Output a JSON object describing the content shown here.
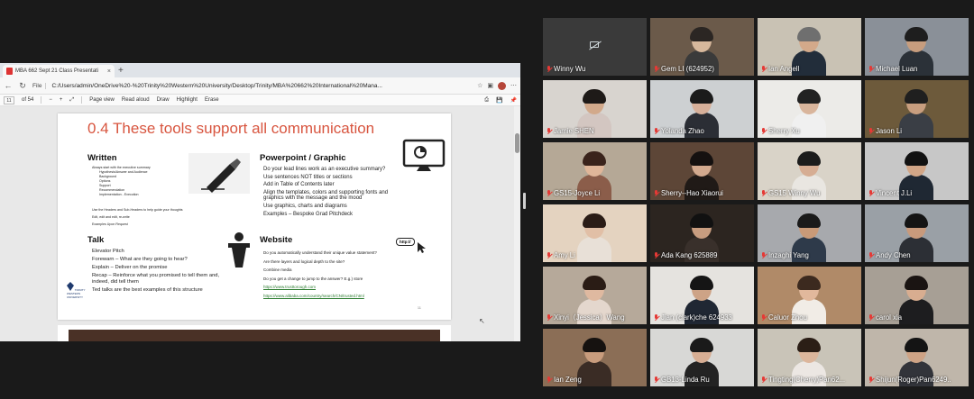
{
  "browser": {
    "tab_title": "MBA 662 Sept 21 Class Presentati",
    "tab_close": "×",
    "new_tab": "+",
    "file_label": "File",
    "url": "C:/Users/admin/OneDrive%20-%20Trinity%20Western%20University/Desktop/Trinity/MBA%20662%20International%20Mana...",
    "page_input": "11",
    "page_total": "of 54",
    "toolbar": [
      "Page view",
      "Read aloud",
      "Draw",
      "Highlight",
      "Erase"
    ]
  },
  "slide": {
    "title": "0.4  These tools support all communication",
    "written": {
      "heading": "Written",
      "bullets": [
        "Always start with the executive summary"
      ],
      "sub_bullets": [
        "Hypothesis/Answer and Audience",
        "Background",
        "Options",
        "Support",
        "Recommendation",
        "Implementation - Execution"
      ],
      "more_bullets": [
        "Use the Headers and Sub-Headers to help guide your thoughts",
        "Edit, edit and edit, re-write",
        "Examples Upon Request"
      ]
    },
    "powerpoint": {
      "heading": "Powerpoint / Graphic",
      "bullets": [
        "Do your lead lines work as an executive summary?",
        "Use sentences NOT titles or sections",
        "Add in Table of Contents later",
        "Align the templates, colors and supporting fonts and",
        "graphics with the message and the mood",
        "Use graphics, charts and diagrams",
        "Examples – Bespoke Grad Pitchdeck"
      ]
    },
    "talk": {
      "heading": "Talk",
      "bullets": [
        "Elevator Pitch",
        "Forewarn – What are they going to hear?",
        "Explain – Deliver on the promise",
        "Recap – Reinforce what you promised to tell them and,",
        "indeed, did tell them",
        "Ted talks are the best examples of this structure"
      ]
    },
    "website": {
      "heading": "Website",
      "http_badge": "http://",
      "bullets": [
        "Do you automatically understand their unique value statement?",
        "Are there layers and logical depth to the site?",
        "Combine media",
        "Do you get a change to jump to the answer? E.g.) store"
      ],
      "links": [
        "https://www.trusttorough.com",
        "https://www.alibaba.com/country/search/CN/trusted.html"
      ]
    },
    "logo_text": "TRINITY WESTERN UNIVERSITY",
    "page_number": "11"
  },
  "participants": [
    {
      "name": "Winny Wu",
      "video": false
    },
    {
      "name": "Gem LI (624952)",
      "video": true
    },
    {
      "name": "Ian Angell",
      "video": true,
      "active": true
    },
    {
      "name": "Michael Luan",
      "video": true
    },
    {
      "name": "Jamie SHEN",
      "video": true
    },
    {
      "name": "Yolanda Zhao",
      "video": true
    },
    {
      "name": "Sherry Xu",
      "video": true
    },
    {
      "name": "Jason Li",
      "video": true
    },
    {
      "name": "GS15-Joyce Li",
      "video": true
    },
    {
      "name": "Sherry--Hao Xiaorui",
      "video": true
    },
    {
      "name": "GS15 Winny Wu",
      "video": true
    },
    {
      "name": "Vincent J.Li",
      "video": true
    },
    {
      "name": "Amy Li",
      "video": true
    },
    {
      "name": "Ada Kang 625889",
      "video": true
    },
    {
      "name": "Inzaghi Yang",
      "video": true
    },
    {
      "name": "Andy Chen",
      "video": true
    },
    {
      "name": "Xinyi（Jessica）Wang",
      "video": true
    },
    {
      "name": "Jian (clark)che 624933",
      "video": true
    },
    {
      "name": "Caluor Zhou",
      "video": true
    },
    {
      "name": "carol xia",
      "video": true
    },
    {
      "name": "Ian Zeng",
      "video": true
    },
    {
      "name": "GB13-Linda Ru",
      "video": true
    },
    {
      "name": "Tingting(Cherry)Pan62...",
      "video": true
    },
    {
      "name": "Shijun(Roger)Pan6249..",
      "video": true
    }
  ],
  "colors": {
    "slide_title": "#d8553f",
    "active_speaker": "#d6e24b",
    "muted_mic": "#e53935"
  }
}
